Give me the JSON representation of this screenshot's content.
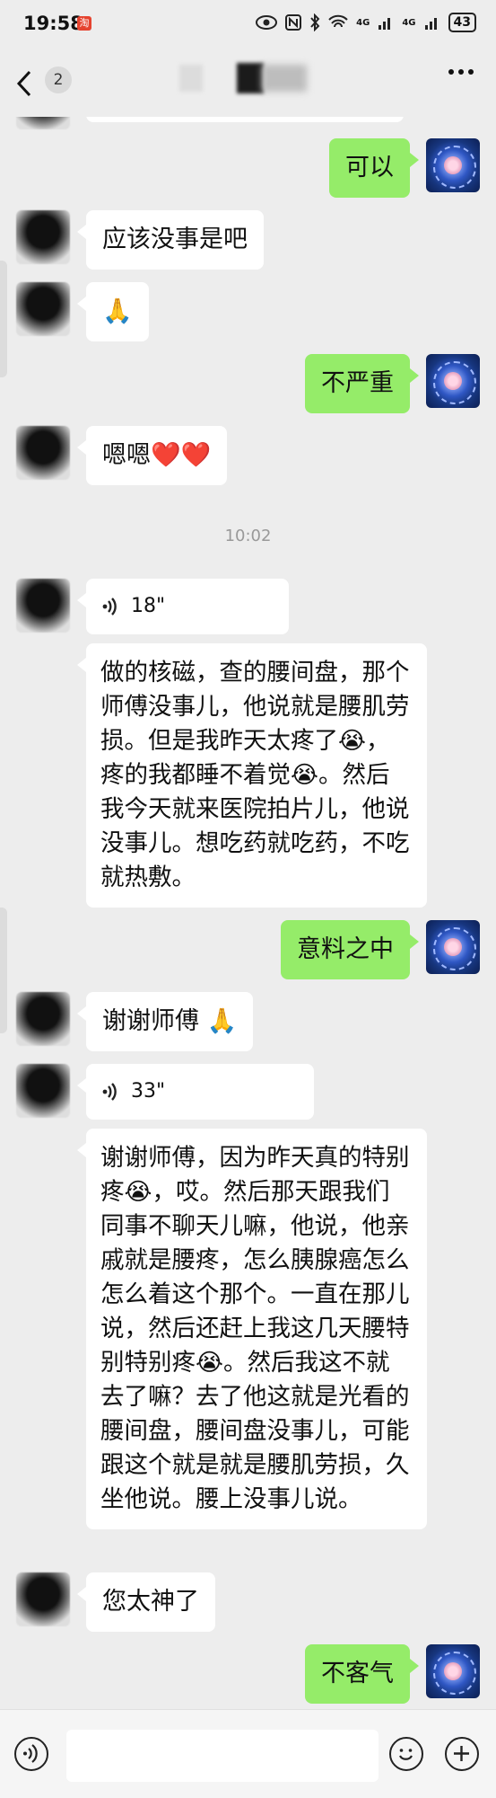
{
  "status_bar": {
    "time": "19:58",
    "app_badge": "淘",
    "network": "4G",
    "network2": "4G",
    "battery": "43"
  },
  "header": {
    "unread_count": "2"
  },
  "messages": [
    {
      "side": "out",
      "text": "可以"
    },
    {
      "side": "in",
      "text": "应该没事是吧"
    },
    {
      "side": "in",
      "text": "🙏"
    },
    {
      "side": "out",
      "text": "不严重"
    },
    {
      "side": "in",
      "text": "嗯嗯❤️❤️"
    },
    {
      "type": "time",
      "text": "10:02"
    },
    {
      "side": "in",
      "type": "voice",
      "duration": "18\""
    },
    {
      "side": "in",
      "text": "做的核磁，查的腰间盘，那个师傅没事儿，他说就是腰肌劳损。但是我昨天太疼了😭，疼的我都睡不着觉😭。然后我今天就来医院拍片儿，他说没事儿。想吃药就吃药，不吃就热敷。"
    },
    {
      "side": "out",
      "text": "意料之中"
    },
    {
      "side": "in",
      "text": "谢谢师傅 🙏"
    },
    {
      "side": "in",
      "type": "voice",
      "duration": "33\""
    },
    {
      "side": "in",
      "text": "谢谢师傅，因为昨天真的特别疼😭，哎。然后那天跟我们同事不聊天儿嘛，他说，他亲戚就是腰疼，怎么胰腺癌怎么怎么着这个那个。一直在那儿说，然后还赶上我这几天腰特别特别疼😭。然后我这不就去了嘛？去了他这就是光看的腰间盘，腰间盘没事儿，可能跟这个就是就是腰肌劳损，久坐他说。腰上没事儿说。"
    },
    {
      "side": "in",
      "text": "您太神了"
    },
    {
      "side": "out",
      "text": "不客气"
    }
  ]
}
